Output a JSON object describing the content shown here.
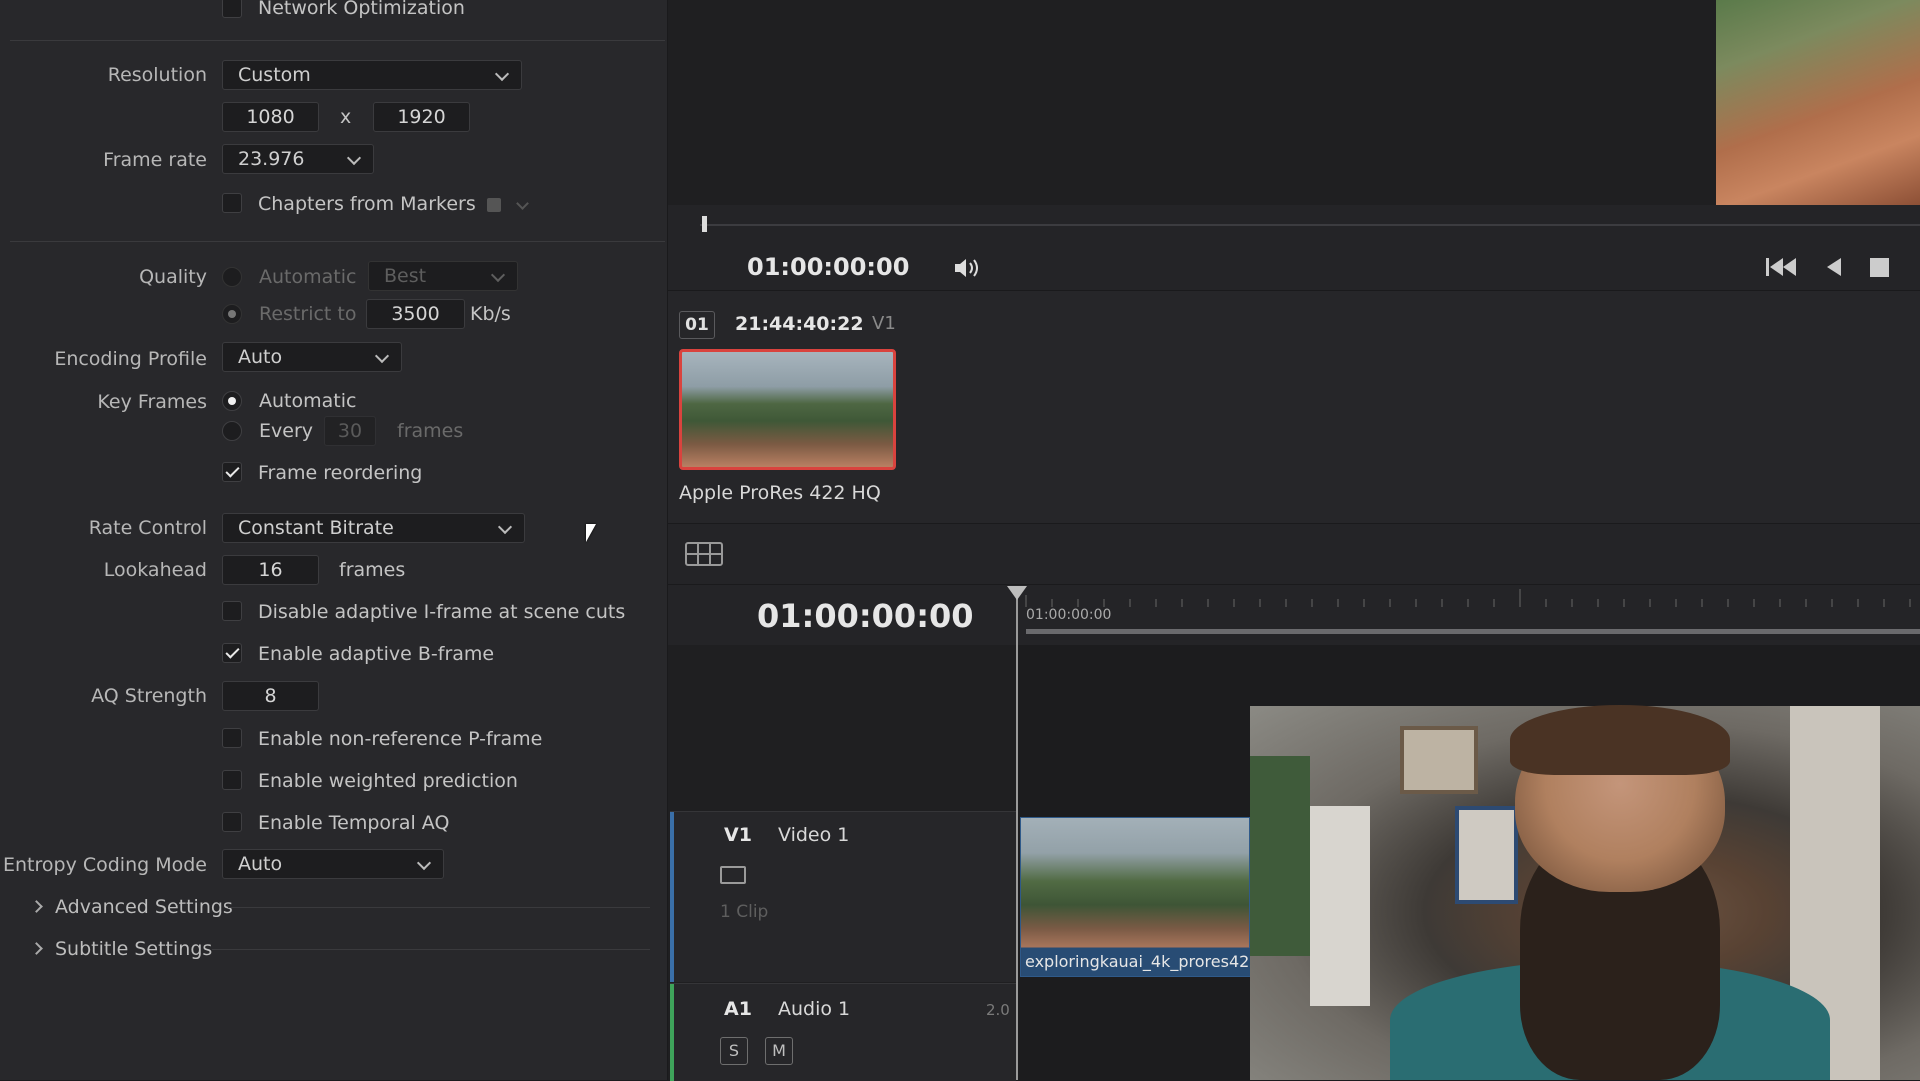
{
  "render_settings": {
    "network_optimization": {
      "label": "Network Optimization",
      "checked": false
    },
    "resolution": {
      "label": "Resolution",
      "value": "Custom",
      "width": "1080",
      "separator": "x",
      "height": "1920"
    },
    "frame_rate": {
      "label": "Frame rate",
      "value": "23.976"
    },
    "chapters": {
      "label": "Chapters from Markers",
      "checked": false
    },
    "quality": {
      "label": "Quality",
      "automatic_label": "Automatic",
      "automatic_value": "Best",
      "restrict_label": "Restrict to",
      "restrict_value": "3500",
      "restrict_unit": "Kb/s"
    },
    "encoding_profile": {
      "label": "Encoding Profile",
      "value": "Auto"
    },
    "key_frames": {
      "label": "Key Frames",
      "automatic_label": "Automatic",
      "every_label": "Every",
      "every_value": "30",
      "every_unit": "frames",
      "frame_reordering_label": "Frame reordering",
      "frame_reordering_checked": true
    },
    "rate_control": {
      "label": "Rate Control",
      "value": "Constant Bitrate"
    },
    "lookahead": {
      "label": "Lookahead",
      "value": "16",
      "unit": "frames"
    },
    "disable_adaptive_iframe": {
      "label": "Disable adaptive I-frame at scene cuts",
      "checked": false
    },
    "enable_adaptive_bframe": {
      "label": "Enable adaptive B-frame",
      "checked": true
    },
    "aq_strength": {
      "label": "AQ Strength",
      "value": "8"
    },
    "enable_nonref_pframe": {
      "label": "Enable non-reference P-frame",
      "checked": false
    },
    "enable_weighted_prediction": {
      "label": "Enable weighted prediction",
      "checked": false
    },
    "enable_temporal_aq": {
      "label": "Enable Temporal AQ",
      "checked": false
    },
    "entropy_coding_mode": {
      "label": "Entropy Coding Mode",
      "value": "Auto"
    },
    "advanced_settings": "Advanced Settings",
    "subtitle_settings": "Subtitle Settings"
  },
  "viewer": {
    "timecode": "01:00:00:00"
  },
  "media_pool": {
    "clip_index": "01",
    "clip_timecode": "21:44:40:22",
    "clip_track": "V1",
    "clip_codec": "Apple ProRes 422 HQ"
  },
  "timeline": {
    "timecode": "01:00:00:00",
    "ruler_start": "01:00:00:00",
    "video_track": {
      "id": "V1",
      "name": "Video 1",
      "clip_count": "1 Clip",
      "clip_name": "exploringkauai_4k_prores422"
    },
    "audio_track": {
      "id": "A1",
      "name": "Audio 1",
      "channels": "2.0",
      "solo": "S",
      "mute": "M"
    }
  },
  "colors": {
    "panel_bg": "#28282b",
    "accent_red": "#d9433e",
    "video_track_accent": "#3a6fa8",
    "audio_track_accent": "#3ea35a"
  }
}
